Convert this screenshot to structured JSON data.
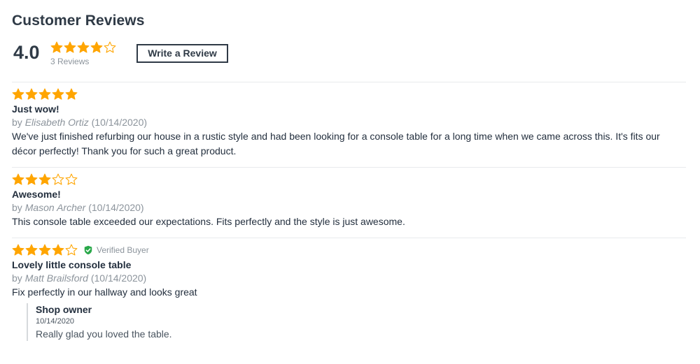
{
  "section_title": "Customer Reviews",
  "summary": {
    "average": "4.0",
    "rating": 4,
    "max_rating": 5,
    "count_text": "3 Reviews",
    "write_review_label": "Write a Review"
  },
  "colors": {
    "star": "#ffa500",
    "text": "#232f3e",
    "muted": "#8c949c",
    "verified": "#2aa84a"
  },
  "reviews": [
    {
      "rating": 5,
      "title": "Just wow!",
      "by": "by ",
      "author": "Elisabeth Ortiz",
      "date": "(10/14/2020)",
      "body": "We've just finished refurbing our house in a rustic style and had been looking for a console table for a long time when we came across this. It's fits our décor perfectly! Thank you for such a great product."
    },
    {
      "rating": 3,
      "title": "Awesome!",
      "by": "by ",
      "author": "Mason Archer",
      "date": "(10/14/2020)",
      "body": "This console table exceeded our expectations. Fits perfectly and the style is just awesome."
    },
    {
      "rating": 4,
      "verified_label": "Verified Buyer",
      "title": "Lovely little console table",
      "by": "by ",
      "author": "Matt Brailsford",
      "date": "(10/14/2020)",
      "body": "Fix perfectly in our hallway and looks great",
      "reply": {
        "author": "Shop owner",
        "date": "10/14/2020",
        "body": "Really glad you loved the table."
      }
    }
  ]
}
